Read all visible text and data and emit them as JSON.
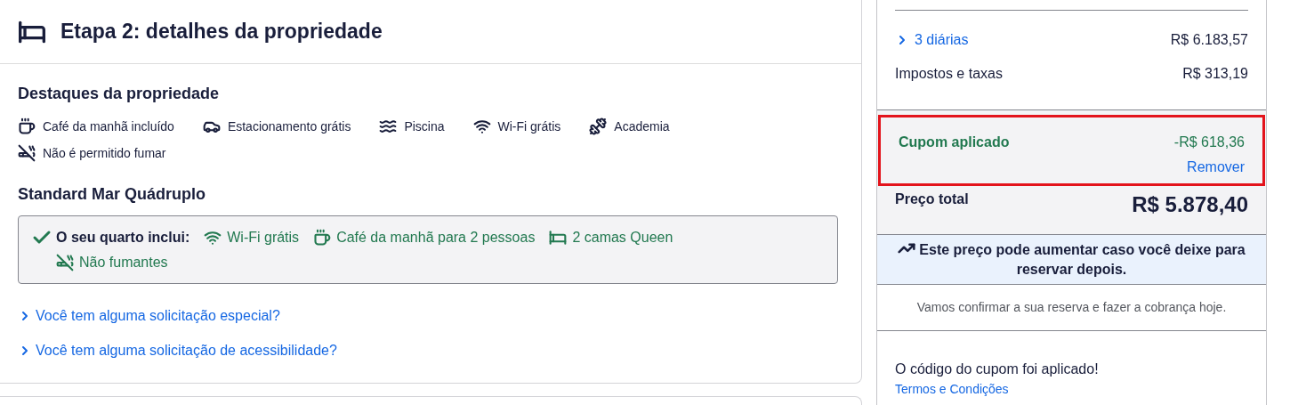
{
  "step": {
    "title": "Etapa 2: detalhes da propriedade"
  },
  "highlights": {
    "title": "Destaques da propriedade",
    "items": [
      {
        "kind": "coffee",
        "label": "Café da manhã incluído"
      },
      {
        "kind": "car",
        "label": "Estacionamento grátis"
      },
      {
        "kind": "pool",
        "label": "Piscina"
      },
      {
        "kind": "wifi",
        "label": "Wi-Fi grátis"
      },
      {
        "kind": "gym",
        "label": "Academia"
      },
      {
        "kind": "nosmoking",
        "label": "Não é permitido fumar"
      }
    ]
  },
  "room": {
    "name": "Standard Mar Quádruplo",
    "includes_label": "O seu quarto inclui:",
    "amenities": [
      {
        "kind": "wifi",
        "label": "Wi-Fi grátis"
      },
      {
        "kind": "coffee",
        "label": "Café da manhã para 2 pessoas"
      },
      {
        "kind": "bed",
        "label": "2 camas Queen"
      },
      {
        "kind": "nosmoking",
        "label": "Não fumantes"
      }
    ]
  },
  "requests": [
    {
      "label": "Você tem alguma solicitação especial?"
    },
    {
      "label": "Você tem alguma solicitação de acessibilidade?"
    }
  ],
  "summary": {
    "lines": [
      {
        "kind": "expandable",
        "label": "3 diárias",
        "amount": "R$ 6.183,57"
      },
      {
        "kind": "plain",
        "label": "Impostos e taxas",
        "amount": "R$ 313,19"
      }
    ],
    "coupon": {
      "label": "Cupom aplicado",
      "amount": "-R$ 618,36",
      "action": "Remover",
      "highlighted": true
    },
    "total": {
      "label": "Preço total",
      "amount": "R$ 5.878,40"
    },
    "notice": "Este preço pode aumentar caso você deixe para reservar depois.",
    "note": "Vamos confirmar a sua reserva e fazer a cobrança hoje.",
    "coupon_message": "O código do cupom foi aplicado!",
    "terms_link": "Termos e Condições"
  }
}
